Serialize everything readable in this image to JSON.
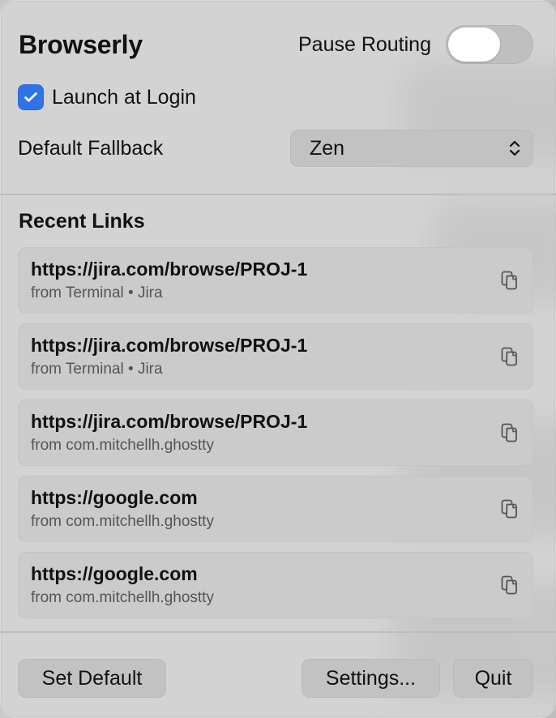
{
  "app": {
    "title": "Browserly"
  },
  "header": {
    "pause_label": "Pause Routing",
    "pause_enabled": false
  },
  "launch_at_login": {
    "label": "Launch at Login",
    "checked": true
  },
  "fallback": {
    "label": "Default Fallback",
    "value": "Zen"
  },
  "recent": {
    "title": "Recent Links",
    "items": [
      {
        "url": "https://jira.com/browse/PROJ-1",
        "meta": "from Terminal • Jira"
      },
      {
        "url": "https://jira.com/browse/PROJ-1",
        "meta": "from Terminal • Jira"
      },
      {
        "url": "https://jira.com/browse/PROJ-1",
        "meta": "from com.mitchellh.ghostty"
      },
      {
        "url": "https://google.com",
        "meta": "from com.mitchellh.ghostty"
      },
      {
        "url": "https://google.com",
        "meta": "from com.mitchellh.ghostty"
      }
    ]
  },
  "footer": {
    "set_default_label": "Set Default",
    "settings_label": "Settings...",
    "quit_label": "Quit"
  },
  "icons": {
    "checkbox": "checkmark-icon",
    "select": "chevron-up-down-icon",
    "copy": "copy-icon"
  },
  "colors": {
    "accent": "#2F73E6",
    "panel": "#D3D3D3",
    "row": "#CBCBCB",
    "button": "#C2C2C2",
    "text": "#111111",
    "muted": "#555555"
  }
}
